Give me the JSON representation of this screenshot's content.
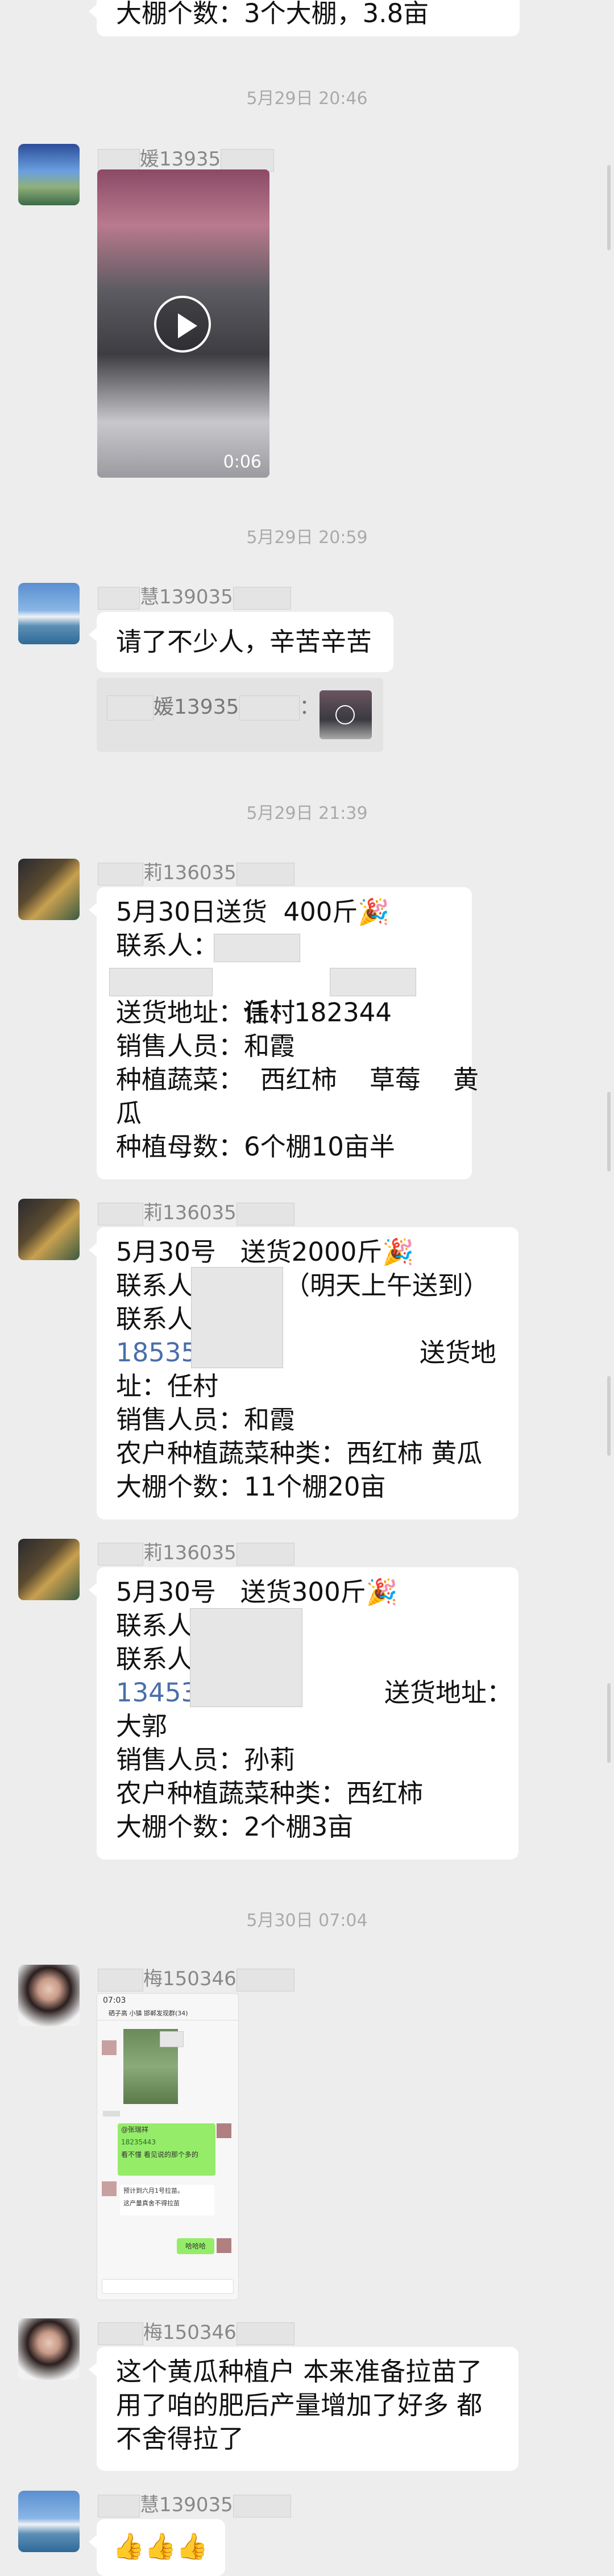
{
  "messages": {
    "top": {
      "text": "大棚个数：3个大棚，3.8亩"
    },
    "ts1": "5月29日 20:46",
    "m1": {
      "sender": "媛13935",
      "duration": "0:06"
    },
    "ts2": "5月29日 20:59",
    "m2": {
      "sender": "慧139035",
      "text": "请了不少人，辛苦辛苦",
      "quote_sender": "媛13935",
      "quote_colon": "："
    },
    "ts3": "5月29日 21:39",
    "m3": {
      "sender": "莉136035",
      "lines": [
        "5月30日送货  400斤🎉",
        "联系人：",
        "话：182344",
        "送货地址：任村",
        "销售人员：和霞",
        "种植蔬菜：  西红柿    草莓    黄",
        "瓜",
        "种植母数：6个棚10亩半"
      ]
    },
    "m4": {
      "sender": "莉136035",
      "lines": [
        "5月30号   送货2000斤🎉",
        "联系人",
        "（明天上午送到）",
        "联系人：",
        "18535",
        "送货地",
        "址：任村",
        "销售人员：和霞",
        "农户种植蔬菜种类：西红柿 黄瓜",
        "大棚个数：11个棚20亩"
      ]
    },
    "m5": {
      "sender": "莉136035",
      "lines": [
        "5月30号   送货300斤🎉",
        "联系人",
        "联系人",
        "13453",
        "送货地址：",
        "大郭",
        "销售人员：孙莉",
        "农户种植蔬菜种类：西红柿",
        "大棚个数：2个棚3亩"
      ]
    },
    "ts4": "5月30日 07:04",
    "m6": {
      "sender": "梅150346",
      "shot": {
        "time": "07:03",
        "title": "硒子高 小镇 邯郸发现群(34)",
        "mention": "@张瑞祥",
        "line2": "18235443",
        "line3": "看不懂 看见说的那个多的",
        "notice1": "预计到六月1号拉苗。",
        "notice2": "这产量真舍不得拉苗",
        "reply": "哈哈哈"
      }
    },
    "m7": {
      "sender": "梅150346",
      "lines": [
        "这个黄瓜种植户 本来准备拉苗了",
        "用了咱的肥后产量增加了好多 都",
        "不舍得拉了"
      ]
    },
    "m8": {
      "sender": "慧139035",
      "text": "👍👍👍"
    }
  },
  "colors": {
    "bg": "#ededed",
    "bubble": "#ffffff",
    "phone": "#4a6ea9",
    "name": "#888888",
    "time": "#aaaaaa"
  },
  "icons": [
    "play-icon",
    "avatar-landscape",
    "avatar-lake",
    "avatar-cartoon",
    "avatar-woman"
  ]
}
